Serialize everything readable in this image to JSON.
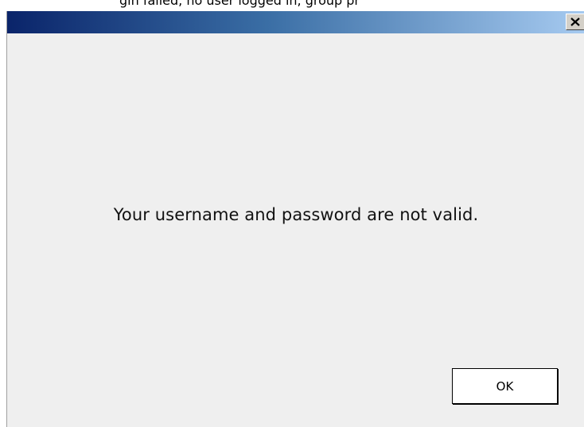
{
  "background_header": {
    "partial_text": "gin failed, no user logged in, group pr"
  },
  "dialog": {
    "title": "",
    "close_icon": "close-x-icon",
    "message": "Your username and password are not valid.",
    "ok_label": "OK",
    "titlebar_colors": [
      "#0a246a",
      "#3a6ea5",
      "#a6caf0"
    ],
    "body_color": "#efefef"
  }
}
